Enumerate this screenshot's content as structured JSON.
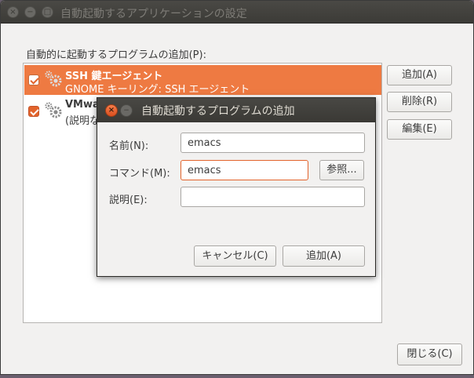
{
  "window": {
    "title": "自動起動するアプリケーションの設定",
    "close_glyph": "×",
    "min_glyph": "−",
    "max_glyph": "□"
  },
  "main": {
    "section_label": "自動的に起動するプログラムの追加(P):",
    "items": [
      {
        "name": "SSH 鍵エージェント",
        "description": "GNOME キーリング: SSH エージェント",
        "checked": true,
        "selected": true,
        "icon": "gears-icon"
      },
      {
        "name": "VMwa",
        "description": "(説明な",
        "checked": true,
        "selected": false,
        "icon": "gears-icon"
      }
    ],
    "buttons": {
      "add": "追加(A)",
      "remove": "削除(R)",
      "edit": "編集(E)"
    },
    "close": "閉じる(C)"
  },
  "dialog": {
    "title": "自動起動するプログラムの追加",
    "close_glyph": "×",
    "min_glyph": "−",
    "name_label": "名前(N):",
    "name_value": "emacs",
    "command_label": "コマンド(M):",
    "command_value": "emacs",
    "browse": "参照...",
    "description_label": "説明(E):",
    "description_value": "",
    "cancel": "キャンセル(C)",
    "add": "追加(A)"
  },
  "colors": {
    "accent": "#ee7a42",
    "titlebar": "#3c3b37",
    "window_bg": "#f2f1f0"
  }
}
